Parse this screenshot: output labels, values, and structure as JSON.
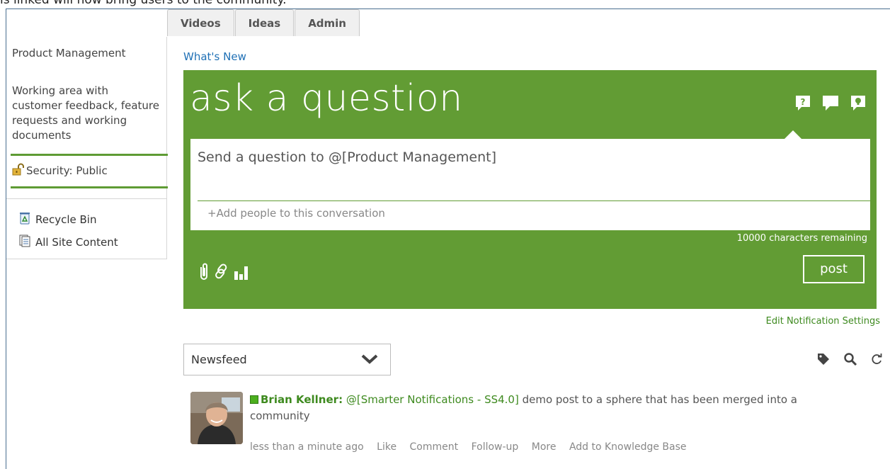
{
  "top_text": "is linked will now bring users to the community.",
  "tabs": [
    {
      "label": "Videos"
    },
    {
      "label": "Ideas"
    },
    {
      "label": "Admin"
    }
  ],
  "sidebar": {
    "title": "Product Management",
    "description": "Working area with customer feedback, feature requests and working documents",
    "security": "Security: Public",
    "links": [
      {
        "label": "Recycle Bin",
        "icon": "recycle-bin-icon"
      },
      {
        "label": "All Site Content",
        "icon": "site-content-icon"
      }
    ]
  },
  "main": {
    "whats_new": "What's New",
    "panel_title": "ask a question",
    "question_placeholder": "Send a question to @[Product Management]",
    "add_people": "+Add people to this conversation",
    "chars_remaining": "10000 characters remaining",
    "post_label": "post",
    "edit_notifications": "Edit Notification Settings",
    "newsfeed_label": "Newsfeed"
  },
  "post": {
    "author": "Brian Kellner",
    "mention": "@[Smarter Notifications - SS4.0]",
    "text": " demo post to a sphere that has been merged into a community",
    "time": "less than a minute ago",
    "actions": [
      "Like",
      "Comment",
      "Follow-up",
      "More",
      "Add to Knowledge Base"
    ]
  },
  "colors": {
    "accent_green": "#629c34",
    "link_blue": "#1f70b5",
    "author_green": "#3e8a1f"
  }
}
